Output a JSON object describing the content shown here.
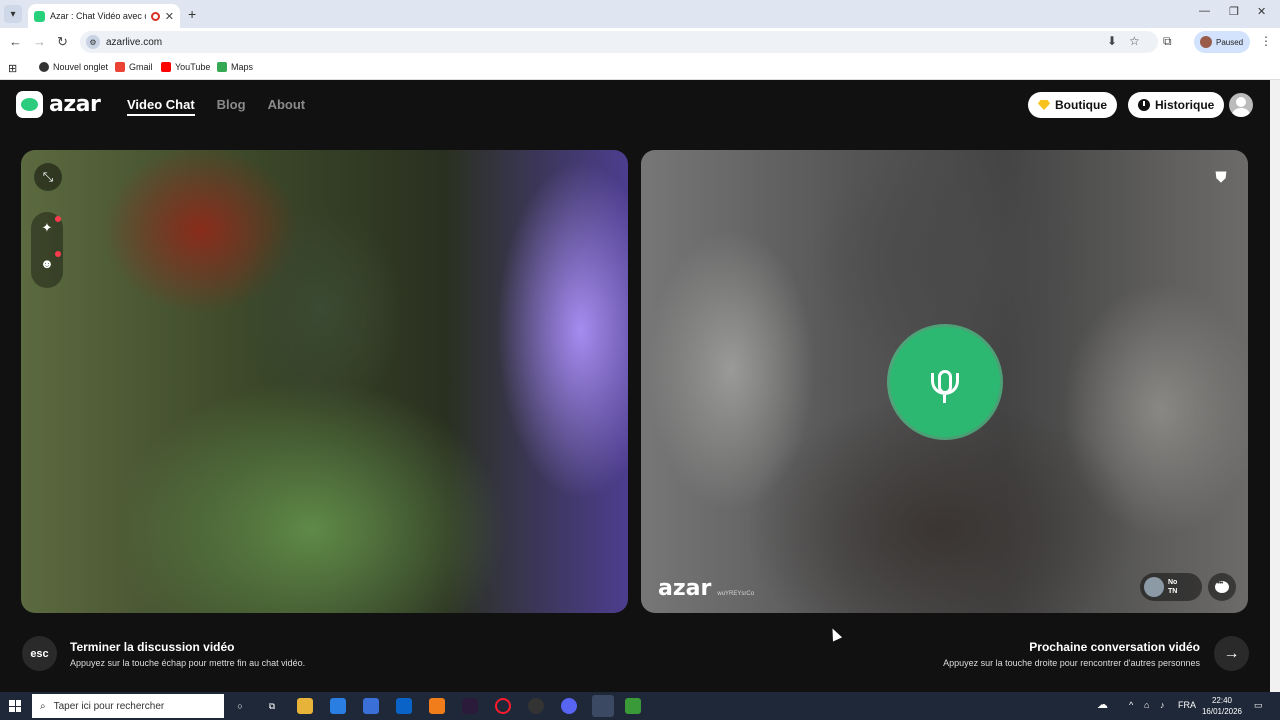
{
  "browser": {
    "tab_title": "Azar : Chat Vidéo avec de n",
    "tab_close": "✕",
    "new_tab": "+",
    "url": "azarlive.com",
    "profile_status": "Paused",
    "bookmarks": [
      "Nouvel onglet",
      "Gmail",
      "YouTube",
      "Maps"
    ],
    "win_minimize": "—",
    "win_restore": "❐",
    "win_close": "✕"
  },
  "site": {
    "logo": "azar",
    "nav": [
      "Video Chat",
      "Blog",
      "About"
    ],
    "boutique": "Boutique",
    "historique": "Historique",
    "partner": {
      "watermark": "azar",
      "watermark_id": "wuYREYsrCo",
      "chip_name": "No",
      "chip_country": "TN"
    },
    "footer_left": {
      "key": "esc",
      "title": "Terminer la discussion vidéo",
      "subtitle": "Appuyez sur la touche échap pour mettre fin au chat vidéo."
    },
    "footer_right": {
      "key": "→",
      "title": "Prochaine conversation vidéo",
      "subtitle": "Appuyez sur la touche droite pour rencontrer d'autres personnes"
    }
  },
  "taskbar": {
    "search_placeholder": "Taper ici pour rechercher",
    "language": "FRA",
    "time": "22:40",
    "date": "16/01/2026"
  },
  "colors": {
    "accent_green": "#2db872",
    "boutique_diamond": "#f6c21b",
    "notification_red": "#ff3b4e"
  }
}
